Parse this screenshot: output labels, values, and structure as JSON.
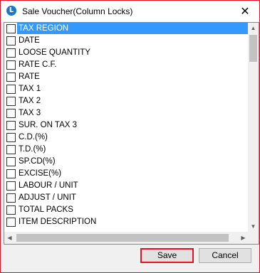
{
  "window": {
    "title": "Sale Voucher(Column Locks)",
    "close_glyph": "✕",
    "icon_glyph": "L"
  },
  "list": {
    "items": [
      {
        "label": "TAX REGION",
        "checked": false,
        "selected": true
      },
      {
        "label": "DATE",
        "checked": false
      },
      {
        "label": "LOOSE QUANTITY",
        "checked": false
      },
      {
        "label": "RATE C.F.",
        "checked": false
      },
      {
        "label": "RATE",
        "checked": false
      },
      {
        "label": "TAX 1",
        "checked": false
      },
      {
        "label": "TAX 2",
        "checked": false
      },
      {
        "label": "TAX 3",
        "checked": false
      },
      {
        "label": "SUR. ON TAX 3",
        "checked": false
      },
      {
        "label": "C.D.(%)",
        "checked": false
      },
      {
        "label": "T.D.(%)",
        "checked": false
      },
      {
        "label": "SP.CD(%)",
        "checked": false
      },
      {
        "label": "EXCISE(%)",
        "checked": false
      },
      {
        "label": "LABOUR / UNIT",
        "checked": false
      },
      {
        "label": "ADJUST / UNIT",
        "checked": false
      },
      {
        "label": "TOTAL PACKS",
        "checked": false
      },
      {
        "label": "ITEM DESCRIPTION",
        "checked": false
      }
    ]
  },
  "buttons": {
    "save": "Save",
    "cancel": "Cancel"
  },
  "colors": {
    "selection": "#3399ff",
    "window_border": "#e81123",
    "app_icon": "#1a76c9"
  },
  "icons": {
    "app": "app-logo-icon",
    "close": "close-icon",
    "scroll_up": "chevron-up-icon",
    "scroll_down": "chevron-down-icon",
    "scroll_left": "chevron-left-icon",
    "scroll_right": "chevron-right-icon"
  }
}
